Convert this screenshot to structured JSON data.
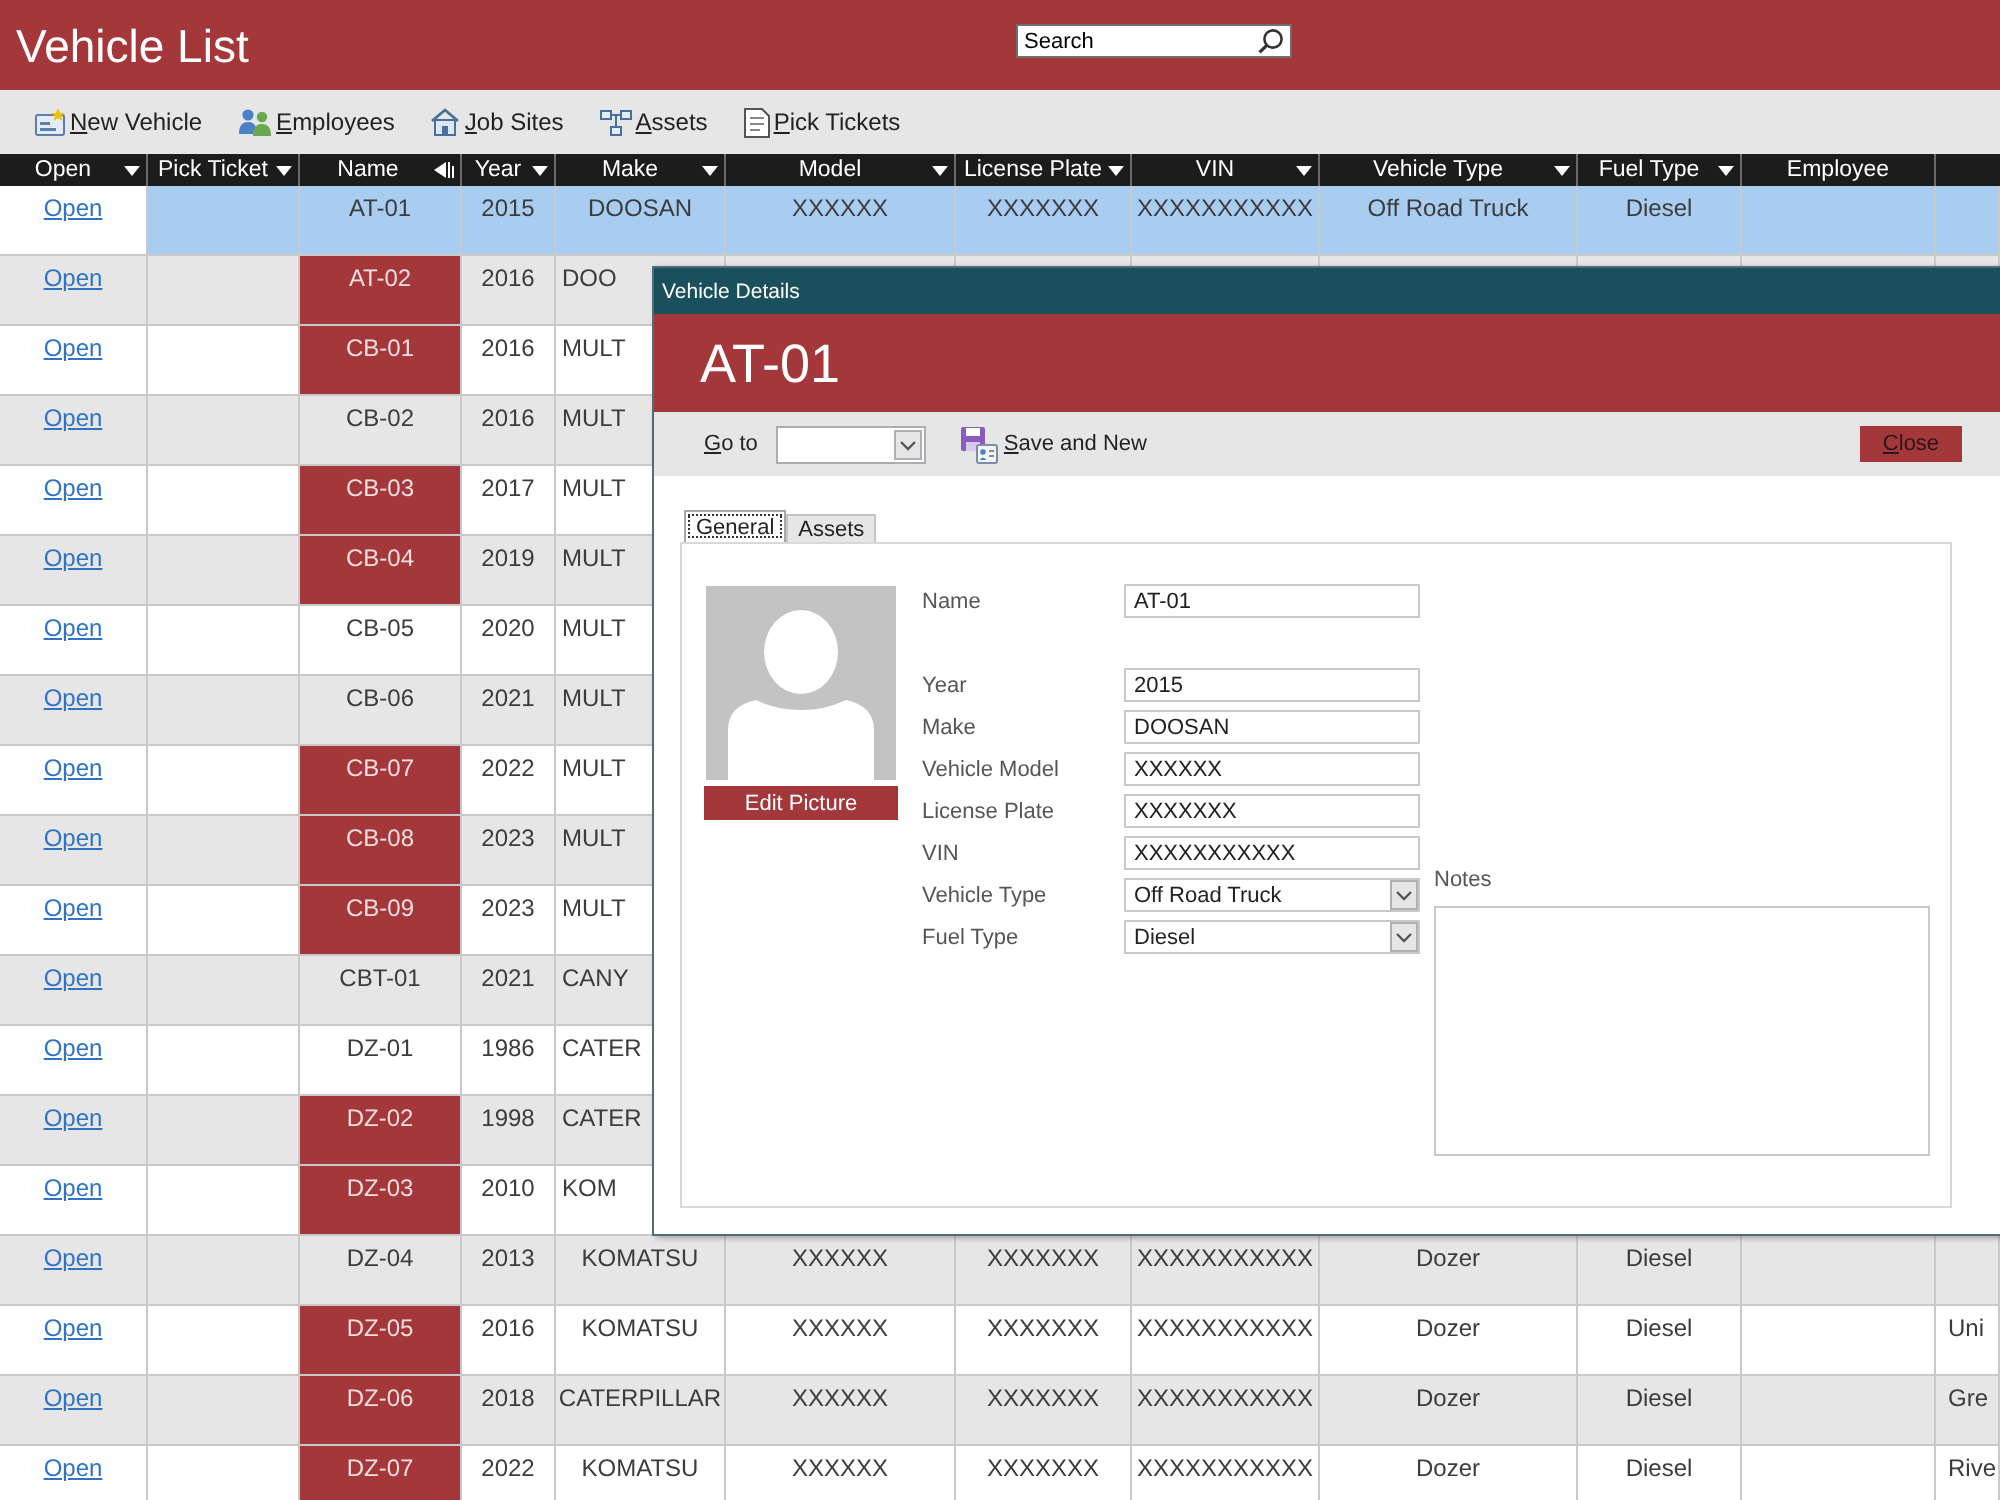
{
  "title_bar": {
    "title": "Vehicle List",
    "search": {
      "placeholder": "Search"
    }
  },
  "toolbar": [
    {
      "label": "New Vehicle",
      "mnemonic": true
    },
    {
      "label": "Employees",
      "mnemonic": true
    },
    {
      "label": "Job Sites",
      "mnemonic": true
    },
    {
      "label": "Assets",
      "mnemonic": true
    },
    {
      "label": "Pick Tickets",
      "mnemonic": true
    }
  ],
  "table": {
    "columns": [
      {
        "label": "Open",
        "filter": true,
        "sorted": false
      },
      {
        "label": "Pick Ticket",
        "filter": true,
        "sorted": false
      },
      {
        "label": "Name",
        "filter": false,
        "sorted": true
      },
      {
        "label": "Year",
        "filter": true,
        "sorted": false
      },
      {
        "label": "Make",
        "filter": true,
        "sorted": false
      },
      {
        "label": "Model",
        "filter": true,
        "sorted": false
      },
      {
        "label": "License Plate",
        "filter": true,
        "sorted": false
      },
      {
        "label": "VIN",
        "filter": true,
        "sorted": false
      },
      {
        "label": "Vehicle Type",
        "filter": true,
        "sorted": false
      },
      {
        "label": "Fuel Type",
        "filter": true,
        "sorted": false
      },
      {
        "label": "Employee",
        "filter": false,
        "sorted": false
      }
    ],
    "rows": [
      {
        "open": "Open",
        "name": "AT-01",
        "flagged": false,
        "selected": true,
        "year": "2015",
        "make": "DOOSAN",
        "model": "XXXXXX",
        "license_plate": "XXXXXXX",
        "vin": "XXXXXXXXXXX",
        "vehicle_type": "Off Road Truck",
        "fuel_type": "Diesel"
      },
      {
        "open": "Open",
        "name": "AT-02",
        "flagged": true,
        "selected": false,
        "year": "2016",
        "make": "DOO"
      },
      {
        "open": "Open",
        "name": "CB-01",
        "flagged": true,
        "selected": false,
        "year": "2016",
        "make": "MULT"
      },
      {
        "open": "Open",
        "name": "CB-02",
        "flagged": false,
        "selected": false,
        "year": "2016",
        "make": "MULT"
      },
      {
        "open": "Open",
        "name": "CB-03",
        "flagged": true,
        "selected": false,
        "year": "2017",
        "make": "MULT"
      },
      {
        "open": "Open",
        "name": "CB-04",
        "flagged": true,
        "selected": false,
        "year": "2019",
        "make": "MULT"
      },
      {
        "open": "Open",
        "name": "CB-05",
        "flagged": false,
        "selected": false,
        "year": "2020",
        "make": "MULT"
      },
      {
        "open": "Open",
        "name": "CB-06",
        "flagged": false,
        "selected": false,
        "year": "2021",
        "make": "MULT"
      },
      {
        "open": "Open",
        "name": "CB-07",
        "flagged": true,
        "selected": false,
        "year": "2022",
        "make": "MULT"
      },
      {
        "open": "Open",
        "name": "CB-08",
        "flagged": true,
        "selected": false,
        "year": "2023",
        "make": "MULT"
      },
      {
        "open": "Open",
        "name": "CB-09",
        "flagged": true,
        "selected": false,
        "year": "2023",
        "make": "MULT"
      },
      {
        "open": "Open",
        "name": "CBT-01",
        "flagged": false,
        "selected": false,
        "year": "2021",
        "make": "CANY"
      },
      {
        "open": "Open",
        "name": "DZ-01",
        "flagged": false,
        "selected": false,
        "year": "1986",
        "make": "CATER"
      },
      {
        "open": "Open",
        "name": "DZ-02",
        "flagged": true,
        "selected": false,
        "year": "1998",
        "make": "CATER"
      },
      {
        "open": "Open",
        "name": "DZ-03",
        "flagged": true,
        "selected": false,
        "year": "2010",
        "make": "KOM"
      },
      {
        "open": "Open",
        "name": "DZ-04",
        "flagged": false,
        "selected": false,
        "year": "2013",
        "make": "KOMATSU",
        "model": "XXXXXX",
        "license_plate": "XXXXXXX",
        "vin": "XXXXXXXXXXX",
        "vehicle_type": "Dozer",
        "fuel_type": "Diesel"
      },
      {
        "open": "Open",
        "name": "DZ-05",
        "flagged": true,
        "selected": false,
        "year": "2016",
        "make": "KOMATSU",
        "model": "XXXXXX",
        "license_plate": "XXXXXXX",
        "vin": "XXXXXXXXXXX",
        "vehicle_type": "Dozer",
        "fuel_type": "Diesel",
        "column_12": "Uni"
      },
      {
        "open": "Open",
        "name": "DZ-06",
        "flagged": true,
        "selected": false,
        "year": "2018",
        "make": "CATERPILLAR",
        "model": "XXXXXX",
        "license_plate": "XXXXXXX",
        "vin": "XXXXXXXXXXX",
        "vehicle_type": "Dozer",
        "fuel_type": "Diesel",
        "column_12": "Gre"
      },
      {
        "open": "Open",
        "name": "DZ-07",
        "flagged": true,
        "selected": false,
        "year": "2022",
        "make": "KOMATSU",
        "model": "XXXXXX",
        "license_plate": "XXXXXXX",
        "vin": "XXXXXXXXXXX",
        "vehicle_type": "Dozer",
        "fuel_type": "Diesel",
        "column_12": "Rive"
      }
    ]
  },
  "dialog": {
    "title": "Vehicle Details",
    "heading": "AT-01",
    "go_to": {
      "label": "Go to",
      "mnemonic": true
    },
    "save_and_new": {
      "label": "Save and New",
      "mnemonic": true
    },
    "close": {
      "label": "Close",
      "mnemonic": true
    },
    "tabs": [
      {
        "label": "General",
        "selected": true
      },
      {
        "label": "Assets",
        "selected": false
      }
    ],
    "edit_picture": "Edit Picture",
    "fields": [
      {
        "label": "Name",
        "kind": "text",
        "value": "AT-01"
      },
      {
        "label": "Year",
        "kind": "text",
        "value": "2015"
      },
      {
        "label": "Make",
        "kind": "text",
        "value": "DOOSAN"
      },
      {
        "label": "Vehicle Model",
        "kind": "text",
        "value": "XXXXXX"
      },
      {
        "label": "License Plate",
        "kind": "text",
        "value": "XXXXXXX"
      },
      {
        "label": "VIN",
        "kind": "text",
        "value": "XXXXXXXXXXX"
      },
      {
        "label": "Vehicle Type",
        "kind": "select",
        "value": "Off Road Truck"
      },
      {
        "label": "Fuel Type",
        "kind": "select",
        "value": "Diesel"
      }
    ],
    "notes": {
      "label": "Notes"
    }
  }
}
